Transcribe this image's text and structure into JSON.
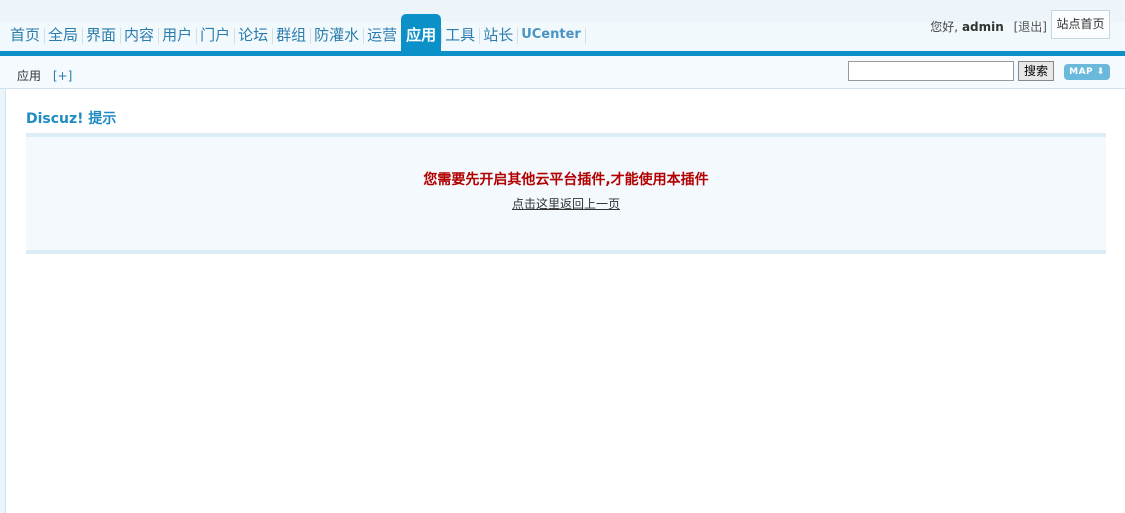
{
  "nav": {
    "items": [
      {
        "label": "首页"
      },
      {
        "label": "全局"
      },
      {
        "label": "界面"
      },
      {
        "label": "内容"
      },
      {
        "label": "用户"
      },
      {
        "label": "门户"
      },
      {
        "label": "论坛"
      },
      {
        "label": "群组"
      },
      {
        "label": "防灌水"
      },
      {
        "label": "运营"
      },
      {
        "label": "应用",
        "active": true
      },
      {
        "label": "工具"
      },
      {
        "label": "站长"
      },
      {
        "label": "UCenter"
      }
    ]
  },
  "user": {
    "greeting": "您好,",
    "name": "admin",
    "logout_label": "[退出]"
  },
  "header": {
    "home_button_label": "站点首页"
  },
  "subbar": {
    "crumb_label": "应用",
    "add_label": "[+]",
    "search_value": "",
    "search_button_label": "搜索",
    "map_label": "MAP ⬇"
  },
  "content": {
    "title": "Discuz! 提示",
    "message": "您需要先开启其他云平台插件,才能使用本插件",
    "back_link": "点击这里返回上一页"
  },
  "colors": {
    "accent": "#0b91c8",
    "nav_text": "#2b7cae",
    "title": "#1e8bc3",
    "error": "#b20000",
    "panel_bg": "#f3f9fd"
  }
}
